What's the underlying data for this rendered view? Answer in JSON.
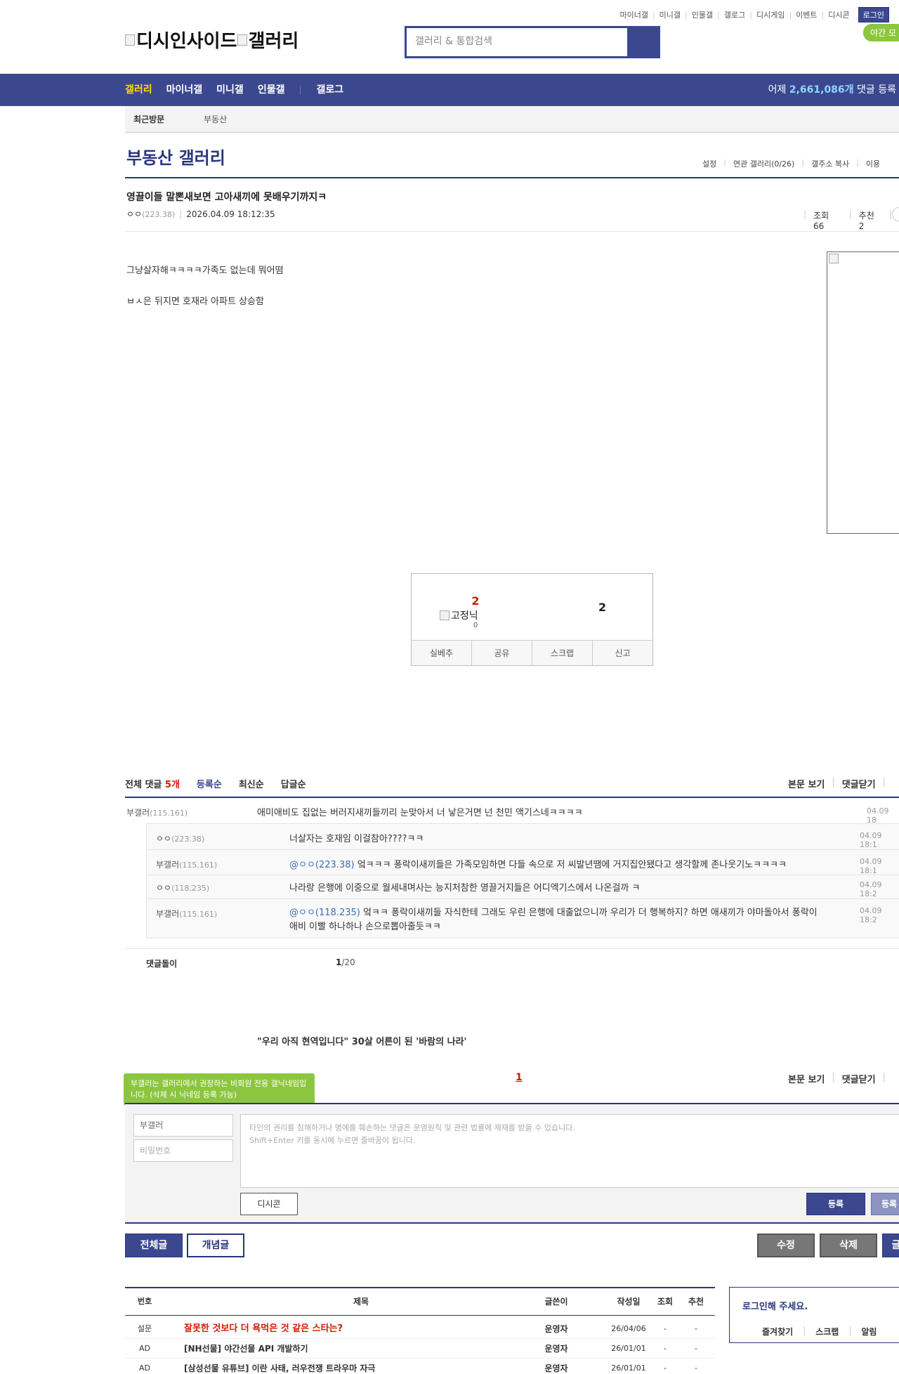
{
  "util": {
    "links": [
      "마이너갤",
      "미니갤",
      "인물갤",
      "갤로그",
      "디시게임",
      "이벤트",
      "디시콘"
    ],
    "login": "로그인"
  },
  "night_mode": "야간 모",
  "logo": {
    "site": "디시인사이드",
    "gallery": "갤러리"
  },
  "search": {
    "placeholder": "갤러리 & 통합검색"
  },
  "gnb": {
    "items": [
      "갤러리",
      "마이너갤",
      "미니갤",
      "인물갤"
    ],
    "gallog": "갤로그",
    "count_prefix": "어제",
    "count": "2,661,086개",
    "count_suffix": "댓글 등록"
  },
  "recent": {
    "label": "최근방문",
    "item": "부동산"
  },
  "gallery": {
    "title": "부동산 갤러리",
    "menu": [
      "설정",
      "연관 갤러리(0/26)",
      "갤주소 복사",
      "이용"
    ]
  },
  "post": {
    "title": "영끌이들 말뽄새보면 고아새끼에 못배우기까지ㅋ",
    "writer": "ㅇㅇ",
    "ip": "(223.38)",
    "date": "2026.04.09 18:12:35",
    "views_label": "조회 66",
    "rec_label": "추천 2",
    "body": [
      "그냥살자해ㅋㅋㅋㅋ가족도 없는데 뭐어떰",
      "ㅂㅅ은 뒤지면 호재라 아파트 상승함"
    ]
  },
  "recommend": {
    "up": "2",
    "fixed_nick": "고정닉",
    "fixed_count": "0",
    "down": "2",
    "buttons": [
      "실베추",
      "공유",
      "스크랩",
      "신고"
    ]
  },
  "comments": {
    "total_label": "전체 댓글",
    "total": "5개",
    "sorts": [
      "등록순",
      "최신순",
      "답글순"
    ],
    "right": [
      "본문 보기",
      "댓글닫기"
    ],
    "list": [
      {
        "nick": "부갤러",
        "ip": "(115.161)",
        "mention": "",
        "mention_ip": "",
        "text": "애미애비도 집없는 버러지새끼들끼리 눈맞아서 너 낳은거면 넌 천민 액기스네ㅋㅋㅋㅋ",
        "date": "04.09 18"
      },
      {
        "nick": "ㅇㅇ",
        "ip": "(223.38)",
        "mention": "",
        "mention_ip": "",
        "text": "너살자는 호재임 이걸참아????ㅋㅋ",
        "date": "04.09 18:1"
      },
      {
        "nick": "부갤러",
        "ip": "(115.161)",
        "mention": "@ㅇㅇ",
        "mention_ip": "(223.38)",
        "text": "엌ㅋㅋㅋ 퐁락이새끼들은 가족모임하면 다들 속으로 저 씨발년땜에 거지집안됐다고 생각할께 존나웃기노ㅋㅋㅋㅋ",
        "date": "04.09 18:1"
      },
      {
        "nick": "ㅇㅇ",
        "ip": "(118.235)",
        "mention": "",
        "mention_ip": "",
        "text": "나라랑 은행에 이중으로 월세내며사는 능지처참한 영끌거지들은 어디엑기스에서 나온걸까 ㅋ",
        "date": "04.09 18:2"
      },
      {
        "nick": "부갤러",
        "ip": "(115.161)",
        "mention": "@ㅇㅇ",
        "mention_ip": "(118.235)",
        "text": "엌ㅋㅋ 퐁락이새끼들 자식한테 그래도 우린 은행에 대출없으니까 우리가 더 행복하지? 하면 애새끼가 야마돌아서 퐁락이",
        "text2": "애비 이빨 하나하나 손으로뽑아줄듯ㅋㅋ",
        "date": "04.09 18:2"
      }
    ],
    "bot_label": "댓글돌이",
    "page_cur": "1",
    "page_total": "/20"
  },
  "news": "\"우리 아직 현역입니다\" 30살 어른이 된 '바람의 나라'",
  "write": {
    "tip": "부갤러는 갤러리에서 권장하는 비회원 전용 갤닉네임입니다. (삭제 시 닉네임 등록 가능)",
    "page": "1",
    "right": [
      "본문 보기",
      "댓글닫기"
    ],
    "nick": "부갤러",
    "pw_placeholder": "비밀번호",
    "placeholder_1": "타인의 권리를 침해하거나 명예를 훼손하는 댓글은 운영원칙 및 관련 법률에 제재를 받을 수 있습니다.",
    "placeholder_2": "Shift+Enter 키를 동시에 누르면 줄바꿈이 됩니다.",
    "dccon": "디시콘",
    "submit": "등록",
    "submit2": "등록"
  },
  "list_buttons": {
    "all": "전체글",
    "concept": "개념글",
    "modify": "수정",
    "delete": "삭제",
    "write": "글"
  },
  "table": {
    "headers": [
      "번호",
      "제목",
      "글쓴이",
      "작성일",
      "조회",
      "추천"
    ],
    "rows": [
      {
        "no": "설문",
        "subject": "잘못한 것보다 더 욕먹은 것 같은 스타는?",
        "writer": "운영자",
        "date": "26/04/06",
        "views": "-",
        "rec": "-"
      },
      {
        "no": "AD",
        "subject": "[NH선물] 야간선물 API 개발하기",
        "writer": "운영자",
        "date": "26/01/01",
        "views": "-",
        "rec": "-"
      },
      {
        "no": "AD",
        "subject": "[삼성선물 유튜브] 이란 사태, 러우전쟁 트라우마 자극",
        "writer": "운영자",
        "date": "26/01/01",
        "views": "-",
        "rec": "-"
      }
    ]
  },
  "loginbox": {
    "title": "로그인해 주세요.",
    "menu": [
      "즐겨찾기",
      "스크랩",
      "알림"
    ]
  },
  "colors": {
    "brand": "#3b4890",
    "brand_dark": "#29367c",
    "accent_red": "#d31900",
    "night_green": "#8cc63f",
    "gnb_active": "#ffde01"
  }
}
